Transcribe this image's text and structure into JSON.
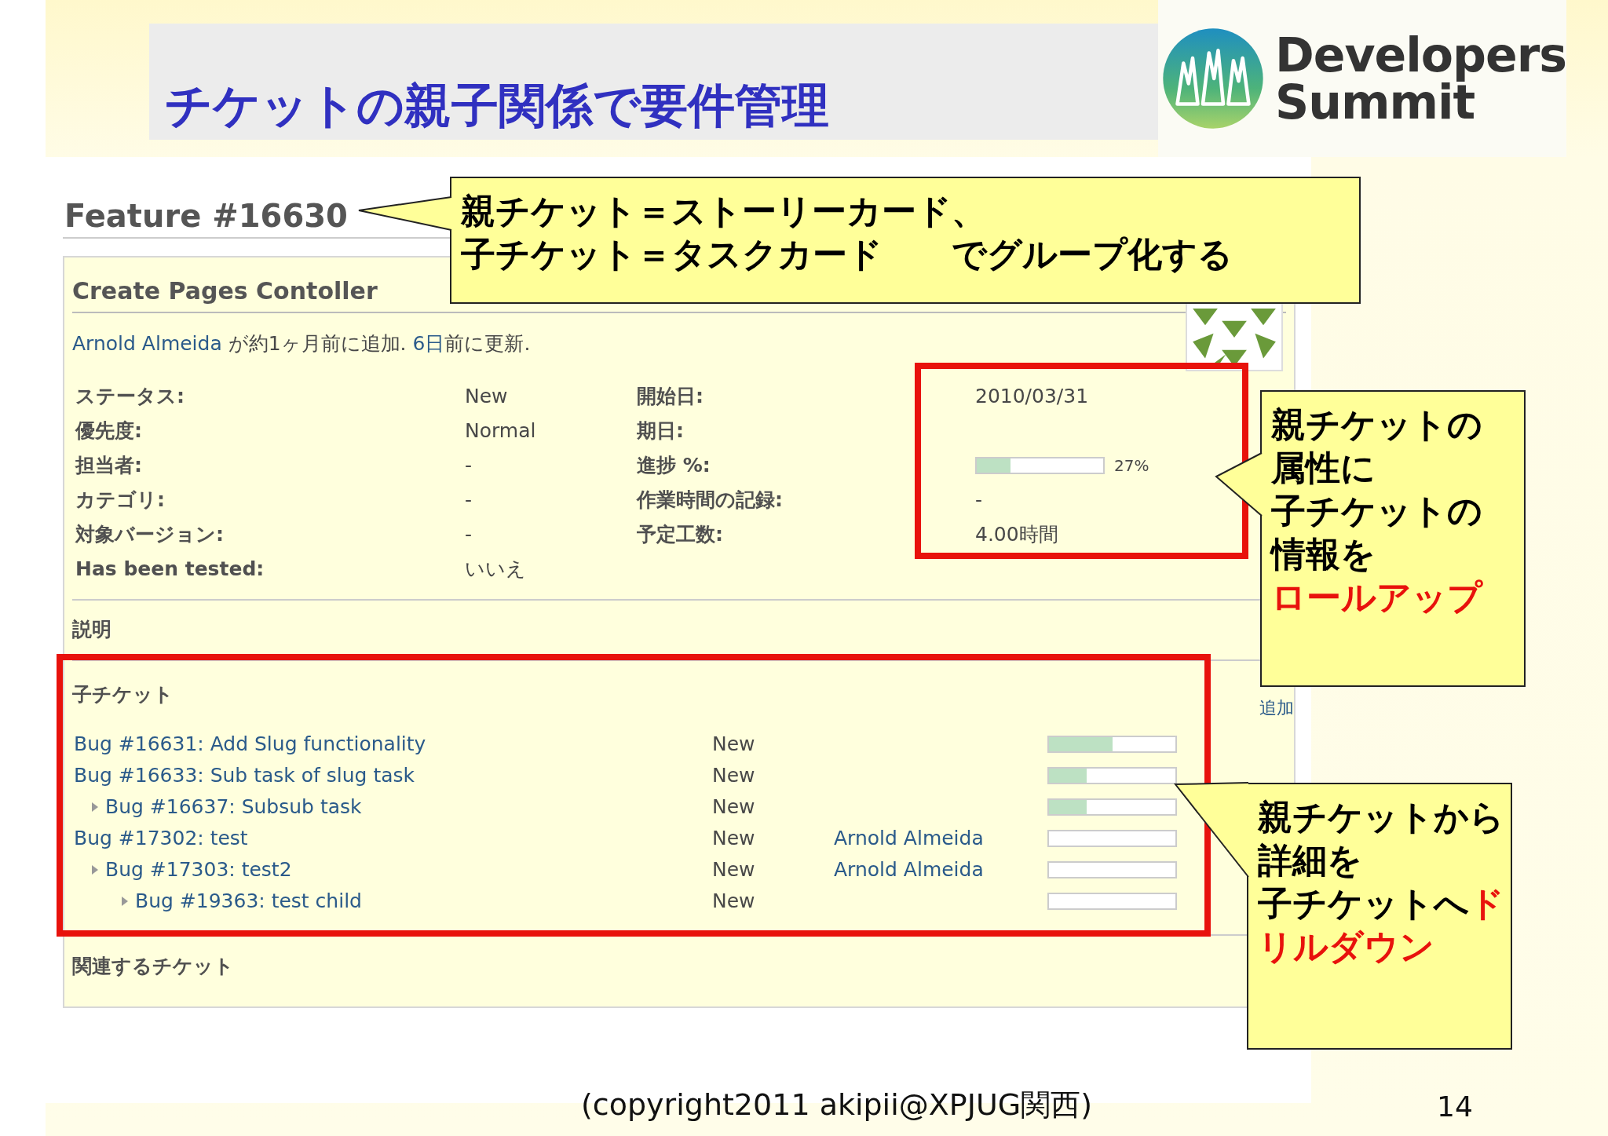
{
  "slide": {
    "title": "チケットの親子関係で要件管理",
    "logo": {
      "line_1": "Developers",
      "line_2": "Summit"
    },
    "copyright": "(copyright2011 akipii@XPJUG関西)",
    "page_number": "14"
  },
  "issue": {
    "heading": "Feature #16630",
    "subject": "Create Pages Contoller",
    "author": "Arnold Almeida",
    "added_text": "が約1ヶ月前に追加.",
    "updated_age": "6日",
    "updated_text": "前に更新.",
    "attributes_left": [
      {
        "label": "ステータス:",
        "value": "New"
      },
      {
        "label": "優先度:",
        "value": "Normal"
      },
      {
        "label": "担当者:",
        "value": "-"
      },
      {
        "label": "カテゴリ:",
        "value": "-"
      },
      {
        "label": "対象バージョン:",
        "value": "-"
      },
      {
        "label": "Has been tested:",
        "value": "いいえ"
      }
    ],
    "attributes_right": [
      {
        "kind": "text",
        "label": "開始日:",
        "value": "2010/03/31"
      },
      {
        "kind": "text",
        "label": "期日:"
      },
      {
        "kind": "progress",
        "label": "進捗 %:",
        "level": 0.27,
        "value": "27%"
      },
      {
        "kind": "text",
        "label": "作業時間の記録:",
        "value": "-"
      },
      {
        "kind": "text",
        "label": "予定工数:",
        "value": "4.00時間"
      }
    ],
    "description_label": "説明",
    "subtasks": {
      "label": "子チケット",
      "add_link": "追加",
      "rows": [
        {
          "title": "Bug #16631: Add Slug functionality",
          "status": "New",
          "level": 0.5
        },
        {
          "title": "Bug #16633: Sub task of slug task",
          "status": "New",
          "level": 0.3,
          "children": [
            {
              "title": "Bug #16637: Subsub task",
              "status": "New",
              "level": 0.3
            }
          ]
        },
        {
          "title": "Bug #17302: test",
          "status": "New",
          "assignee": "Arnold Almeida",
          "level": 0,
          "children": [
            {
              "title": "Bug #17303: test2",
              "status": "New",
              "assignee": "Arnold Almeida",
              "level": 0,
              "children": [
                {
                  "title": "Bug #19363: test child",
                  "status": "New",
                  "level": 0
                }
              ]
            }
          ]
        }
      ]
    },
    "related_label": "関連するチケット"
  },
  "callouts": [
    {
      "lines": [
        [
          {
            "text": "親チケット＝ストーリーカード、",
            "highlight": false
          }
        ],
        [
          {
            "text": "子チケット＝タスクカード　　でグループ化する",
            "highlight": false
          }
        ]
      ]
    },
    {
      "lines": [
        [
          {
            "text": "親チケットの",
            "highlight": false
          }
        ],
        [
          {
            "text": "属性に",
            "highlight": false
          }
        ],
        [
          {
            "text": "子チケットの",
            "highlight": false
          }
        ],
        [
          {
            "text": "情報を",
            "highlight": false
          }
        ],
        [
          {
            "text": "ロールアップ",
            "highlight": true
          }
        ]
      ]
    },
    {
      "lines": [
        [
          {
            "text": "親チケットから",
            "highlight": false
          }
        ],
        [
          {
            "text": "詳細を",
            "highlight": false
          }
        ],
        [
          {
            "text": "子チケットへ",
            "highlight": false
          },
          {
            "text": "ド",
            "highlight": true
          }
        ],
        [
          {
            "text": "リルダウン",
            "highlight": true
          }
        ]
      ]
    }
  ]
}
